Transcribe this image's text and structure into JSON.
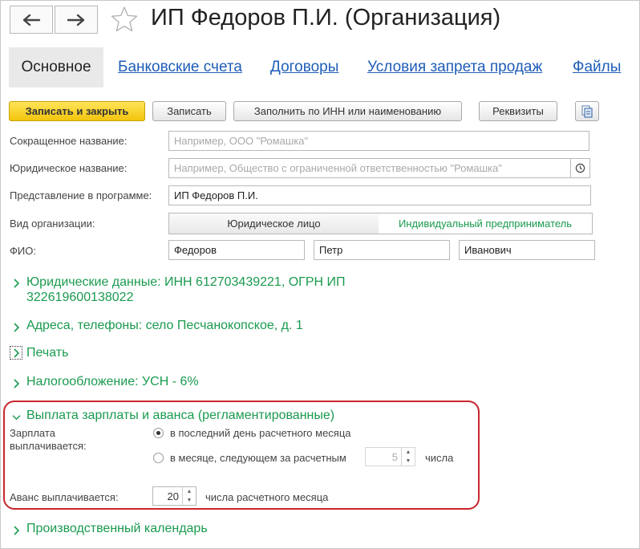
{
  "window": {
    "title": "ИП Федоров П.И. (Организация)"
  },
  "tabs": [
    {
      "label": "Основное"
    },
    {
      "label": "Банковские счета"
    },
    {
      "label": "Договоры"
    },
    {
      "label": "Условия запрета продаж"
    },
    {
      "label": "Файлы"
    }
  ],
  "toolbar": {
    "save_close": "Записать и закрыть",
    "save": "Записать",
    "fill_inn": "Заполнить по ИНН или наименованию",
    "requisites": "Реквизиты"
  },
  "form": {
    "short_name": {
      "label": "Сокращенное название:",
      "placeholder": "Например, ООО \"Ромашка\""
    },
    "legal_name": {
      "label": "Юридическое название:",
      "placeholder": "Например, Общество с ограниченной ответственностью \"Ромашка\""
    },
    "display_name": {
      "label": "Представление в программе:",
      "value": "ИП Федоров П.И."
    },
    "org_type": {
      "label": "Вид организации:",
      "options": [
        "Юридическое лицо",
        "Индивидуальный предприниматель"
      ],
      "selected": "Индивидуальный предприниматель"
    },
    "fio": {
      "label": "ФИО:",
      "last": "Федоров",
      "first": "Петр",
      "middle": "Иванович"
    }
  },
  "groups": {
    "legal": "Юридические данные: ИНН 612703439221, ОГРН ИП 322619600138022",
    "addresses": "Адреса, телефоны: село Песчанокопское, д. 1",
    "print": "Печать",
    "tax": "Налогообложение: УСН - 6%",
    "salary": "Выплата зарплаты и аванса (регламентированные)",
    "calendar": "Производственный календарь"
  },
  "salary": {
    "paid_label": "Зарплата выплачивается:",
    "option1": "в последний день расчетного месяца",
    "option2": "в месяце, следующем за расчетным",
    "day_value": "5",
    "day_suffix": "числа",
    "advance_label": "Аванс выплачивается:",
    "advance_value": "20",
    "advance_suffix": "числа расчетного месяца",
    "selected_option": 1
  },
  "colors": {
    "link": "#1f5db8",
    "group": "#1a9a4f",
    "primary_button": "#f2c40c",
    "highlight_border": "#c9262e"
  }
}
